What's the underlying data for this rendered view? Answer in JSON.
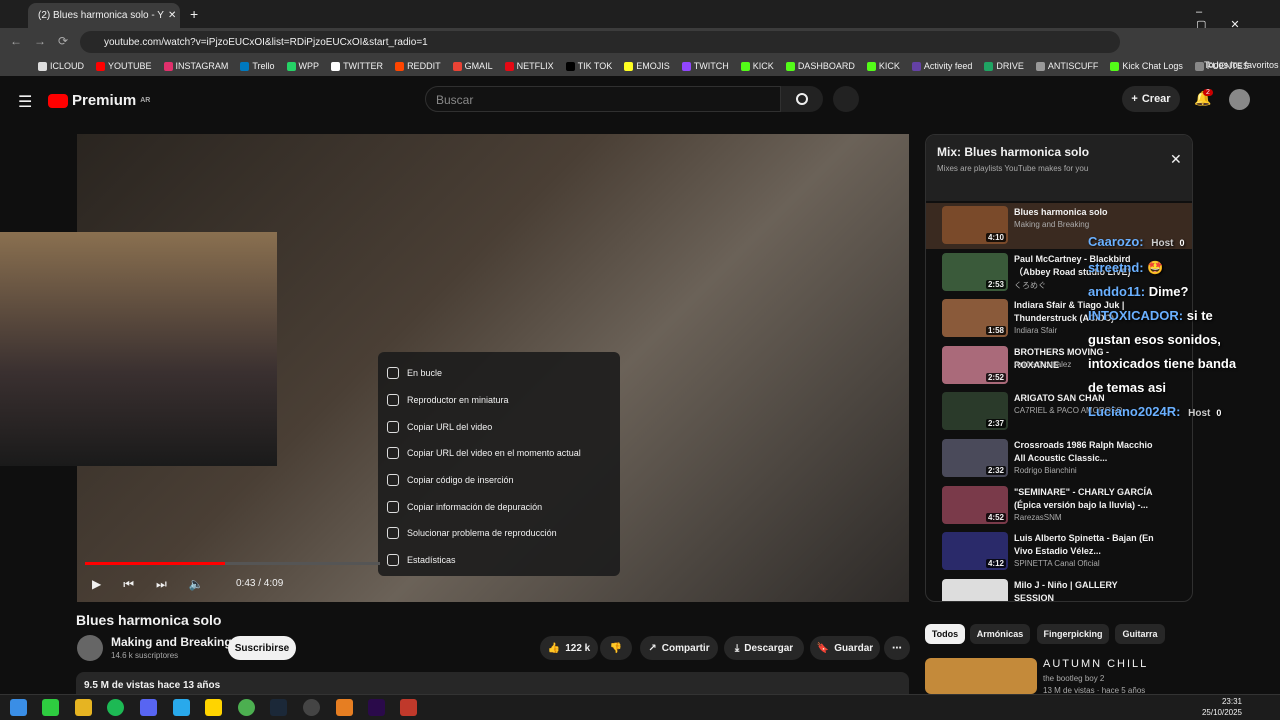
{
  "browser": {
    "tab_title": "(2) Blues harmonica solo - Y",
    "url": "youtube.com/watch?v=iPjzoEUCxOI&list=RDiPjzoEUCxOI&start_radio=1",
    "bookmarks": [
      "ICLOUD",
      "YOUTUBE",
      "INSTAGRAM",
      "Trello",
      "WPP",
      "TWITTER",
      "REDDIT",
      "GMAIL",
      "NETFLIX",
      "TIK TOK",
      "EMOJIS",
      "TWITCH",
      "KICK",
      "DASHBOARD",
      "KICK",
      "Activity feed",
      "DRIVE",
      "ANTISCUFF",
      "Kick Chat Logs",
      "FUENTES"
    ],
    "all_bookmarks": "Todos los favoritos"
  },
  "header": {
    "brand": "Premium",
    "region": "AR",
    "search_placeholder": "Buscar",
    "create": "Crear",
    "notif_count": "2"
  },
  "player": {
    "title": "Blues harmonica solo",
    "time": "0:43 / 4:09",
    "progress": 0.17,
    "context_menu": [
      "En bucle",
      "Reproductor en miniatura",
      "Copiar URL del video",
      "Copiar URL del video en el momento actual",
      "Copiar código de inserción",
      "Copiar información de depuración",
      "Solucionar problema de reproducción",
      "Estadísticas"
    ]
  },
  "channel": {
    "name": "Making and Breaking",
    "subs": "14.6 k suscriptores",
    "subscribe": "Suscribirse"
  },
  "actions": {
    "likes": "122 k",
    "share": "Compartir",
    "download": "Descargar",
    "save": "Guardar"
  },
  "description": {
    "views": "9.5 M de vistas  hace 13 años"
  },
  "playlist": {
    "title": "Mix: Blues harmonica solo",
    "subtitle": "Mixes are playlists YouTube makes for you",
    "items": [
      {
        "title": "Blues harmonica solo",
        "author": "Making and Breaking",
        "dur": "4:10"
      },
      {
        "title": "Paul McCartney - Blackbird （Abbey Road studio LIVE)",
        "author": "くろめぐ",
        "dur": "2:53"
      },
      {
        "title": "Indiara Sfair & Tiago Juk | Thunderstruck (AC/DC)",
        "author": "Indiara Sfair",
        "dur": "1:58"
      },
      {
        "title": "BROTHERS MOVING - ROXANNE",
        "author": "Andre Gonzalez",
        "dur": "2:52"
      },
      {
        "title": "ARIGATO SAN CHAN",
        "author": "CA7RIEL & PACO AMOROSO",
        "dur": "2:37"
      },
      {
        "title": "Crossroads 1986 Ralph Macchio All Acoustic Classic...",
        "author": "Rodrigo Bianchini",
        "dur": "2:32"
      },
      {
        "title": "\"SEMINARE\" - CHARLY GARCÍA (Épica versión bajo la lluvia) -...",
        "author": "RarezasSNM",
        "dur": "4:52"
      },
      {
        "title": "Luis Alberto Spinetta - Bajan (En Vivo Estadio Vélez...",
        "author": "SPINETTA Canal Oficial",
        "dur": "4:12"
      },
      {
        "title": "Milo J - Niño | GALLERY SESSION",
        "author": "",
        "dur": "3:43"
      }
    ]
  },
  "chat": {
    "lines": [
      {
        "user": "Caarozo:",
        "msg": "",
        "tag": "Host",
        "n": "0"
      },
      {
        "user": "streetnd:",
        "msg": "🤩"
      },
      {
        "user": "anddo11:",
        "msg": "Dime?"
      },
      {
        "user": "INTOXICADOR:",
        "msg": "si te"
      },
      {
        "user": "",
        "msg": "gustan esos sonidos,"
      },
      {
        "user": "",
        "msg": "intoxicados tiene banda"
      },
      {
        "user": "",
        "msg": "de temas asi"
      },
      {
        "user": "Luciano2024R:",
        "msg": "",
        "tag": "Host",
        "n": "0"
      }
    ]
  },
  "chips": [
    "Todos",
    "Armónicas",
    "Fingerpicking",
    "Guitarra"
  ],
  "recommended": {
    "title": "AUTUMN CHILL",
    "channel": "the bootleg boy 2",
    "meta": "13 M de vistas · hace 5 años"
  },
  "clock": {
    "time": "23:31",
    "date": "25/10/2025"
  }
}
